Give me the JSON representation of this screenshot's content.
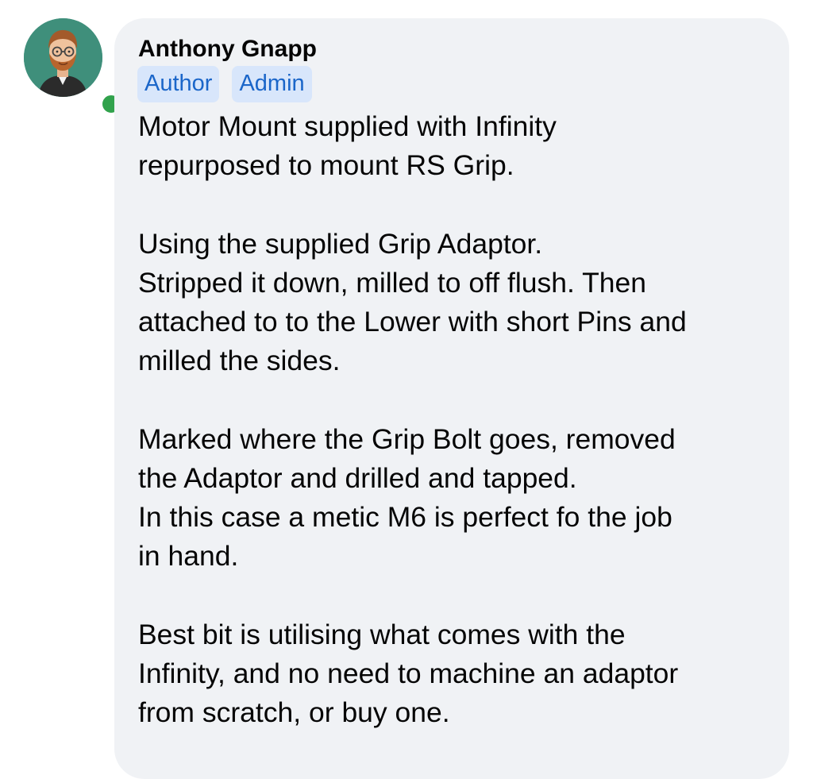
{
  "comment": {
    "author": {
      "name": "Anthony Gnapp",
      "avatar_icon": "cartoon-avatar-icon",
      "online": true
    },
    "badges": [
      {
        "label": "Author"
      },
      {
        "label": "Admin"
      }
    ],
    "paragraphs": [
      {
        "lines": [
          "Motor Mount supplied with Infinity",
          "repurposed to mount RS Grip."
        ]
      },
      {
        "lines": [
          "Using the supplied Grip Adaptor.",
          "Stripped it down, milled to off flush. Then",
          "attached to to the Lower with short Pins and",
          "milled the sides."
        ]
      },
      {
        "lines": [
          "Marked where the Grip Bolt goes, removed",
          "the Adaptor and drilled and tapped.",
          "In this case a metic M6 is perfect fo the job",
          "in hand."
        ]
      },
      {
        "lines": [
          "Best bit is utilising what comes with the",
          "Infinity, and no need to machine an adaptor",
          "from scratch, or buy one."
        ]
      }
    ]
  },
  "colors": {
    "bubble_bg": "#f0f2f5",
    "badge_bg": "#d8e6fb",
    "badge_text": "#1b66c9",
    "online_dot": "#31a24c",
    "avatar_bg": "#3f8f7b"
  }
}
